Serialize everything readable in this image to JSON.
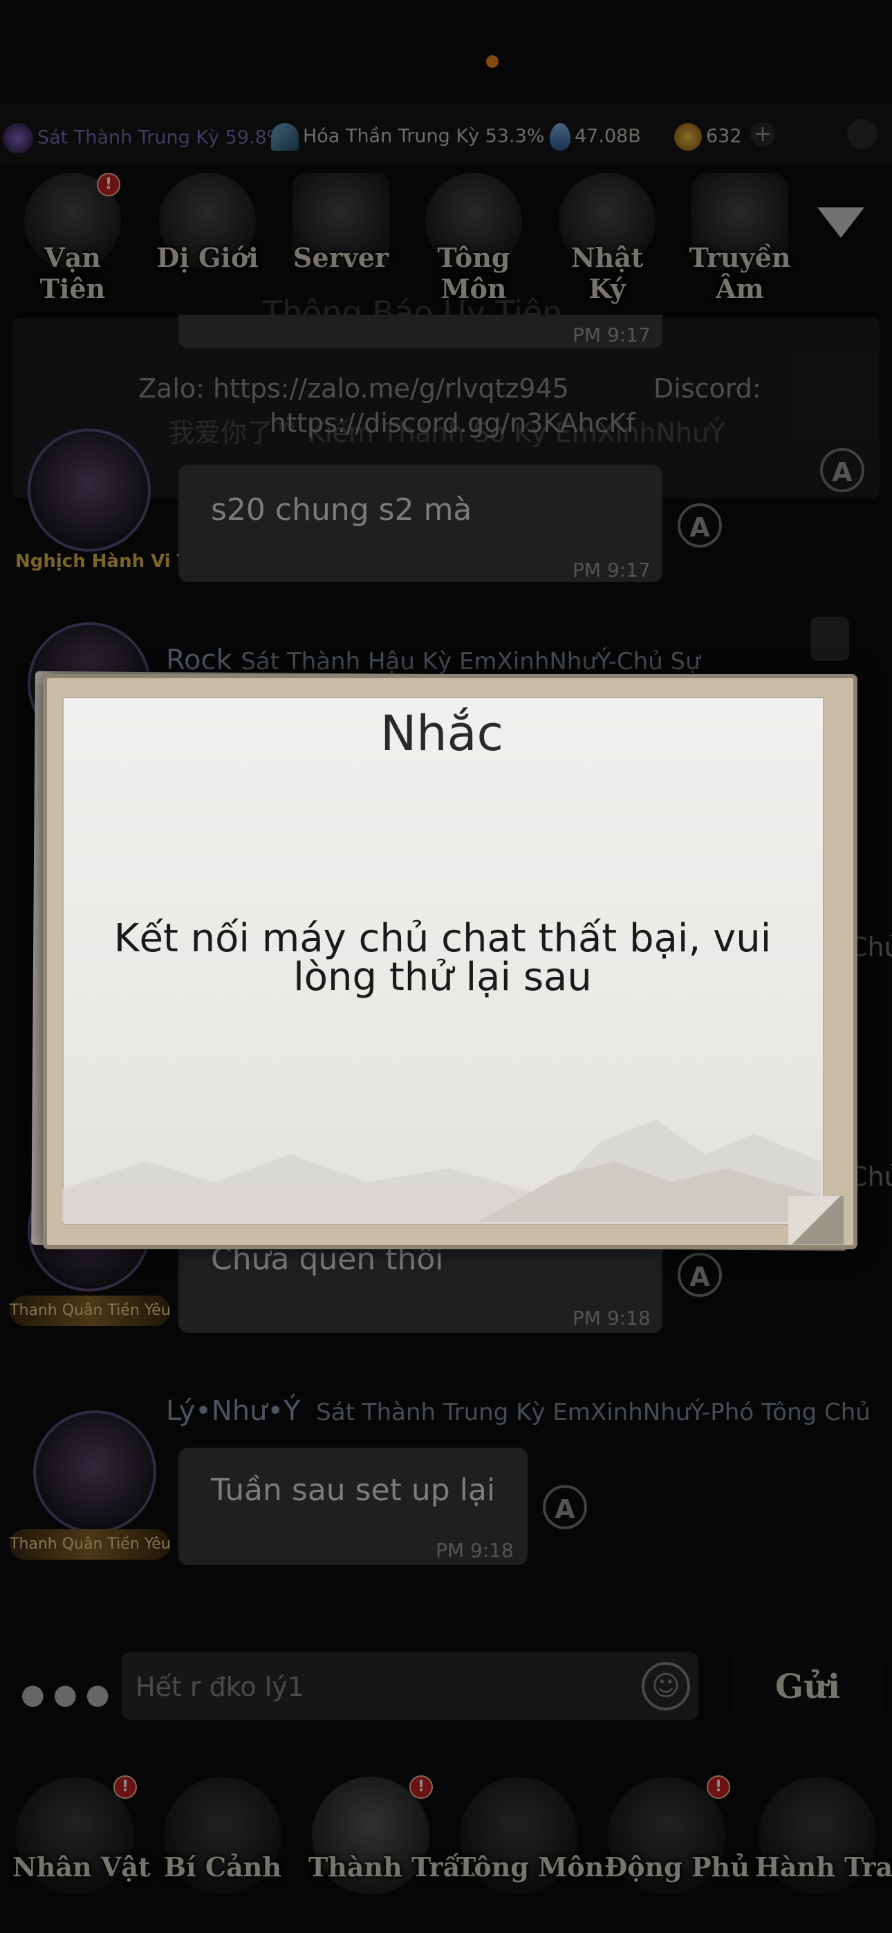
{
  "stats": {
    "stat1": "Sát Thành Trung Kỳ 59.8%",
    "stat2": "Hóa Thần Trung Kỳ 53.3%",
    "currency1": "47.08B",
    "currency2": "632",
    "plus": "+"
  },
  "top_tabs": [
    "Vạn Tiên",
    "Dị Giới",
    "Server",
    "Tông Môn",
    "Nhật Ký",
    "Truyền Âm"
  ],
  "notice": {
    "title": "Thông Báo Uy Tiên",
    "zalo": "Zalo: https://zalo.me/g/rlvqtz945",
    "discord_label": "Discord:",
    "discord_url": "https://discord.gg/n3KAhcKf",
    "ghost": "我爱你了™ Kiếm Thánh Sơ Kỳ EmXinhNhưÝ"
  },
  "messages": [
    {
      "tag": "Nghịch Hành Vi Tiên",
      "text": "s20 chung s2 mà",
      "time": "PM 9:17"
    },
    {
      "sender": "Rock",
      "rank": "Sát Thành Hậu Kỳ  EmXinhNhưÝ-Chủ Sự"
    },
    {
      "tag": "Thanh Quân Tiền Yêu",
      "text": "Chưa quen thôi",
      "time": "PM 9:18"
    },
    {
      "sender": "Lý•Như•Ý",
      "rank": "Sát Thành Trung Kỳ  EmXinhNhưÝ-Phó Tông Chủ",
      "tag": "Thanh Quân Tiền Yêu",
      "text": "Tuần sau set up lại",
      "time": "PM 9:18"
    }
  ],
  "partial": {
    "chu1": "Chủ",
    "chu2": "Chủ",
    "time_top": "PM 9:17"
  },
  "modal": {
    "title": "Nhắc",
    "message": "Kết nối máy chủ chat thất bại, vui lòng thử lại sau"
  },
  "input": {
    "placeholder": "Hết r đko lý1",
    "send": "Gửi"
  },
  "bottom_tabs": [
    "Nhân Vật",
    "Bí Cảnh",
    "Thành Trấn",
    "Tông Môn",
    "Động Phủ",
    "Hành Trang"
  ],
  "colors": {
    "accent": "#f0861f",
    "badge": "#c42323",
    "modal_paper": "#efeeeb"
  }
}
